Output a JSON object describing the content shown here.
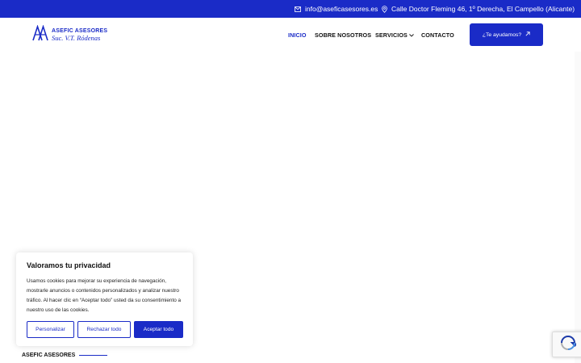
{
  "topbar": {
    "email": "info@aseficasesores.es",
    "address": "Calle Doctor Fleming 46, 1º Derecha, El Campello (Alicante)"
  },
  "brand": {
    "name": "ASEFIC ASESORES",
    "subtitle": "Suc. V.T. Ródenas"
  },
  "nav": {
    "items": [
      {
        "label": "INICIO"
      },
      {
        "label": "SOBRE NOSOTROS"
      },
      {
        "label": "SERVICIOS"
      },
      {
        "label": "CONTACTO"
      }
    ],
    "cta": "¿Te ayudamos?"
  },
  "cookie": {
    "title": "Valoramos tu privacidad",
    "text": "Usamos cookies para mejorar su experiencia de navegación, mostrarle anuncios o contenidos personalizados y analizar nuestro tráfico. Al hacer clic en “Aceptar todo” usted da su consentimiento a nuestro uso de las cookies.",
    "customize": "Personalizar",
    "reject": "Rechazar todo",
    "accept": "Aceptar todo"
  },
  "footer": {
    "label": "ASEFIC ASESORES"
  },
  "colors": {
    "primary": "#1a2bc7"
  }
}
